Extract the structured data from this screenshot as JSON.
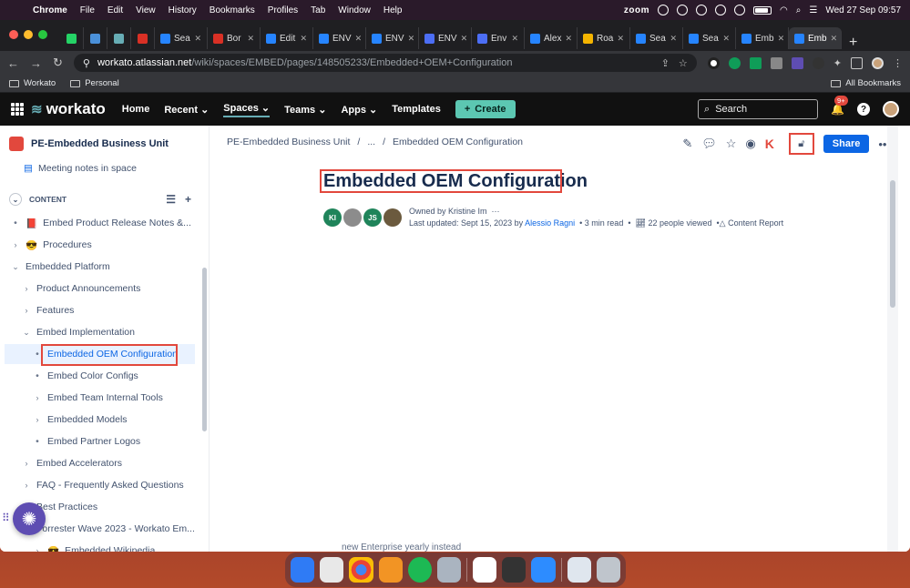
{
  "menubar": {
    "items": [
      "Chrome",
      "File",
      "Edit",
      "View",
      "History",
      "Bookmarks",
      "Profiles",
      "Tab",
      "Window",
      "Help"
    ],
    "zoom": "zoom",
    "clock": "Wed 27 Sep  09:57"
  },
  "tabs": [
    {
      "label": "",
      "color": "#25d366"
    },
    {
      "label": "",
      "color": "#4a90d9"
    },
    {
      "label": "",
      "color": "#67ADB5"
    },
    {
      "label": "",
      "color": "#d93025"
    },
    {
      "label": "Sea",
      "color": "#2684ff"
    },
    {
      "label": "Bor",
      "color": "#d93025"
    },
    {
      "label": "Edit",
      "color": "#2684ff"
    },
    {
      "label": "ENV",
      "color": "#2684ff"
    },
    {
      "label": "ENV",
      "color": "#2684ff"
    },
    {
      "label": "ENV",
      "color": "#4c6ef5"
    },
    {
      "label": "Env",
      "color": "#4c6ef5"
    },
    {
      "label": "Alex",
      "color": "#2684ff"
    },
    {
      "label": "Roa",
      "color": "#f4b400"
    },
    {
      "label": "Sea",
      "color": "#2684ff"
    },
    {
      "label": "Sea",
      "color": "#2684ff"
    },
    {
      "label": "Emb",
      "color": "#2684ff"
    },
    {
      "label": "Emb",
      "color": "#2684ff",
      "active": true
    }
  ],
  "address": {
    "host": "workato.atlassian.net",
    "path": "/wiki/spaces/EMBED/pages/148505233/Embedded+OEM+Configuration"
  },
  "bookmarks": {
    "items": [
      "Workato",
      "Personal"
    ],
    "all": "All Bookmarks"
  },
  "topnav": {
    "logo": "workato",
    "items": [
      "Home",
      "Recent",
      "Spaces",
      "Teams",
      "Apps",
      "Templates"
    ],
    "create": "Create",
    "search_placeholder": "Search",
    "notif_badge": "9+"
  },
  "sidebar": {
    "space_name": "PE-Embedded Business Unit",
    "meeting_notes": "Meeting notes in space",
    "content_label": "CONTENT",
    "tree": [
      {
        "label": "Embed Product Release Notes &...",
        "level": 0,
        "kind": "dot",
        "emoji": "📕"
      },
      {
        "label": "Procedures",
        "level": 0,
        "kind": "chev",
        "emoji": "😎"
      },
      {
        "label": "Embedded Platform",
        "level": 0,
        "kind": "open"
      },
      {
        "label": "Product Announcements",
        "level": 1,
        "kind": "chev"
      },
      {
        "label": "Features",
        "level": 1,
        "kind": "chev"
      },
      {
        "label": "Embed Implementation",
        "level": 1,
        "kind": "open"
      },
      {
        "label": "Embedded OEM Configuration",
        "level": 2,
        "kind": "dot",
        "selected": true
      },
      {
        "label": "Embed Color Configs",
        "level": 2,
        "kind": "dot"
      },
      {
        "label": "Embed Team Internal Tools",
        "level": 2,
        "kind": "chev"
      },
      {
        "label": "Embedded Models",
        "level": 2,
        "kind": "chev"
      },
      {
        "label": "Embed Partner Logos",
        "level": 2,
        "kind": "dot"
      },
      {
        "label": "Embed Accelerators",
        "level": 1,
        "kind": "chev"
      },
      {
        "label": "FAQ - Frequently Asked Questions",
        "level": 1,
        "kind": "chev"
      },
      {
        "label": "Best Practices",
        "level": 1,
        "kind": "chev"
      },
      {
        "label": "Forrester Wave 2023 - Workato Em...",
        "level": 1,
        "kind": "chev"
      },
      {
        "label": "Embedded Wikipedia",
        "level": 2,
        "kind": "chev",
        "emoji": "😎"
      }
    ]
  },
  "page": {
    "breadcrumb": [
      "PE-Embedded Business Unit",
      "/",
      "...",
      "/",
      "Embedded OEM Configuration"
    ],
    "share": "Share",
    "title": "Embedded OEM Configuration",
    "owned_by": "Owned by Kristine Im",
    "owned_more": "···",
    "updated_prefix": "Last updated: Sept 15, 2023 by ",
    "updated_by": "Alessio Ragni",
    "read_time": "3 min read",
    "viewed": "22 people viewed",
    "content_report": "Content Report",
    "avatars": [
      "KI",
      "",
      "JS",
      ""
    ],
    "bottom_fragment": "new Enterprise yearly instead"
  }
}
